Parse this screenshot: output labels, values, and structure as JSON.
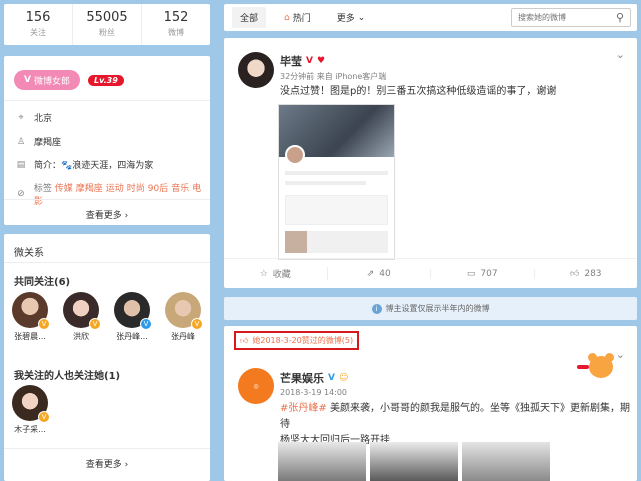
{
  "stats": [
    {
      "num": "156",
      "label": "关注"
    },
    {
      "num": "55005",
      "label": "粉丝"
    },
    {
      "num": "152",
      "label": "微博"
    }
  ],
  "profile": {
    "fan_badge": "微博女郎",
    "level": "Lv.39",
    "location": "北京",
    "constellation": "摩羯座",
    "bio_label": "简介：",
    "bio": "浪迹天涯，四海为家",
    "tags_label": "标签",
    "tags": [
      "传媒",
      "摩羯座",
      "运动",
      "时尚",
      "90后",
      "音乐",
      "电影"
    ],
    "more": "查看更多 ›"
  },
  "relations": {
    "title": "微关系",
    "common_title": "共同关注(6)",
    "common": [
      {
        "name": "张碧晨..."
      },
      {
        "name": "洪欣"
      },
      {
        "name": "张丹峰..."
      },
      {
        "name": "张丹峰"
      }
    ],
    "followers_title": "我关注的人也关注她(1)",
    "followers": [
      {
        "name": "木子采..."
      }
    ],
    "more": "查看更多 ›"
  },
  "tabs": {
    "all": "全部",
    "hot": "热门",
    "more": "更多",
    "search_placeholder": "搜索她的微博"
  },
  "post1": {
    "user": "毕莹",
    "time": "32分钟前",
    "source": "来自 iPhone客户端",
    "text": "没点过赞！图是p的！别三番五次搞这种低级造谣的事了，谢谢",
    "actions": {
      "fav": "收藏",
      "repost": "40",
      "comment": "707",
      "like": "283"
    }
  },
  "notice": "博主设置仅展示半年内的微博",
  "post2": {
    "date_filter": "她2018-3-20赞过的微博(5)",
    "user": "芒果娱乐",
    "time": "2018-3-19 14:00",
    "hashtag": "#张丹峰#",
    "text1": " 美颜来袭，小哥哥的颜我是服气的。坐等《独孤天下》更新剧集，期待",
    "text2": "杨坚大大回归后一路开挂"
  },
  "colors": {
    "accent": "#eb7350",
    "fan_pink": "#f28ab5",
    "level_red": "#e6162d",
    "highlight_border": "#d8191c"
  }
}
